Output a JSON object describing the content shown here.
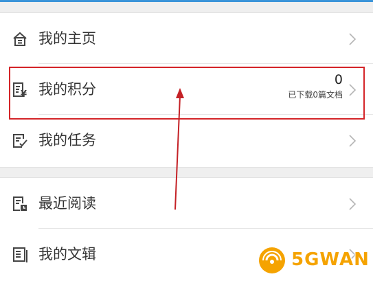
{
  "menu": {
    "home": {
      "label": "我的主页",
      "icon": "home-icon"
    },
    "points": {
      "label": "我的积分",
      "icon": "points-icon",
      "value": "0",
      "subtext": "已下载0篇文档"
    },
    "tasks": {
      "label": "我的任务",
      "icon": "tasks-icon"
    },
    "recent": {
      "label": "最近阅读",
      "icon": "recent-reading-icon"
    },
    "collections": {
      "label": "我的文辑",
      "icon": "collection-icon"
    }
  },
  "watermark": {
    "text": "5GWAN"
  },
  "colors": {
    "highlight": "#d42428",
    "accent": "#3b94d9",
    "watermark": "#f5a300",
    "background": "#efefef"
  }
}
